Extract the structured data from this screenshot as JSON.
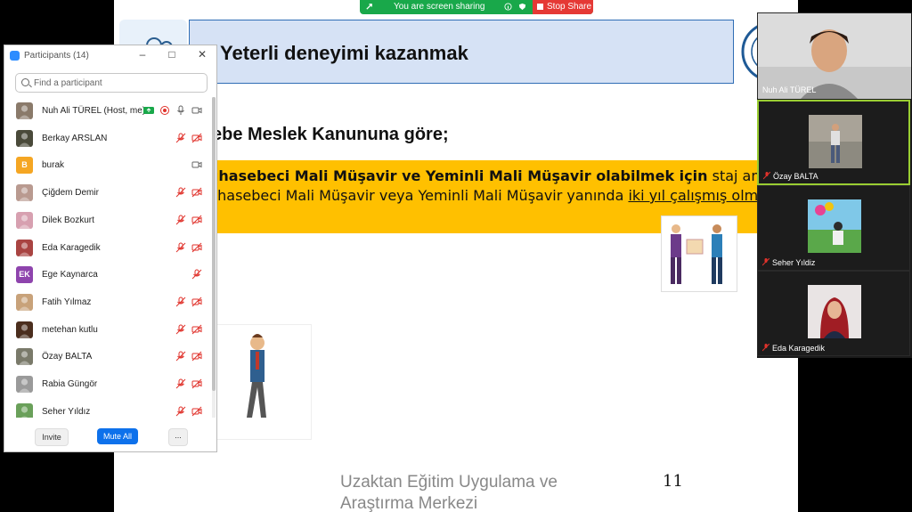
{
  "share_bar": {
    "status": "You are screen sharing",
    "stop_label": "Stop Share"
  },
  "slide": {
    "title": "Yeterli deneyimi kazanmak",
    "heading": "ebe Meslek Kanununa göre;",
    "line1_bold": "uhasebeci Mali Müşavir ve Yeminli Mali Müşavir olabilmek için",
    "line1_rest": " staj amacıy",
    "line2_plain": "uhasebeci Mali Müşavir veya Yeminli Mali Müşavir yanında ",
    "line2_underline": "iki yıl çalışmış olma",
    "footer_line1": "Uzaktan Eğitim Uygulama ve",
    "footer_line2": "Araştırma Merkezi",
    "page_number": "11"
  },
  "participants_panel": {
    "title": "Participants (14)",
    "search_placeholder": "Find a participant",
    "invite_label": "Invite",
    "mute_all_label": "Mute All",
    "more_label": "...",
    "participants": [
      {
        "name": "Nuh Ali TÜREL (Host, me)",
        "avatar": "photo",
        "color": "#8a7a6a"
      },
      {
        "name": "Berkay ARSLAN",
        "avatar": "photo",
        "color": "#4a4a3a"
      },
      {
        "name": "burak",
        "avatar": "B",
        "color": "#f5a623"
      },
      {
        "name": "Çiğdem Demir",
        "avatar": "photo",
        "color": "#b99a90"
      },
      {
        "name": "Dilek Bozkurt",
        "avatar": "photo",
        "color": "#d7a0b0"
      },
      {
        "name": "Eda Karagedik",
        "avatar": "photo",
        "color": "#a94442"
      },
      {
        "name": "Ege Kaynarca",
        "avatar": "EK",
        "color": "#8e44ad"
      },
      {
        "name": "Fatih Yılmaz",
        "avatar": "photo",
        "color": "#c8a27a"
      },
      {
        "name": "metehan kutlu",
        "avatar": "photo",
        "color": "#4b2e1e"
      },
      {
        "name": "Özay BALTA",
        "avatar": "photo",
        "color": "#7a7a6a"
      },
      {
        "name": "Rabia Güngör",
        "avatar": "photo",
        "color": "#9a9a9a"
      },
      {
        "name": "Seher Yıldız",
        "avatar": "photo",
        "color": "#6aa05a"
      }
    ]
  },
  "gallery": {
    "tiles": [
      {
        "name": "Nuh Ali TÜREL",
        "muted": false
      },
      {
        "name": "Özay BALTA",
        "muted": true
      },
      {
        "name": "Seher Yıldiz",
        "muted": true
      },
      {
        "name": "Eda Karagedik",
        "muted": true
      }
    ]
  },
  "colors": {
    "share_green": "#19a84a",
    "stop_red": "#e53935",
    "zoom_blue": "#0e71eb",
    "slide_yellow": "#ffc000",
    "title_blue_bg": "#d6e2f5",
    "muted_red": "#e0322b"
  }
}
